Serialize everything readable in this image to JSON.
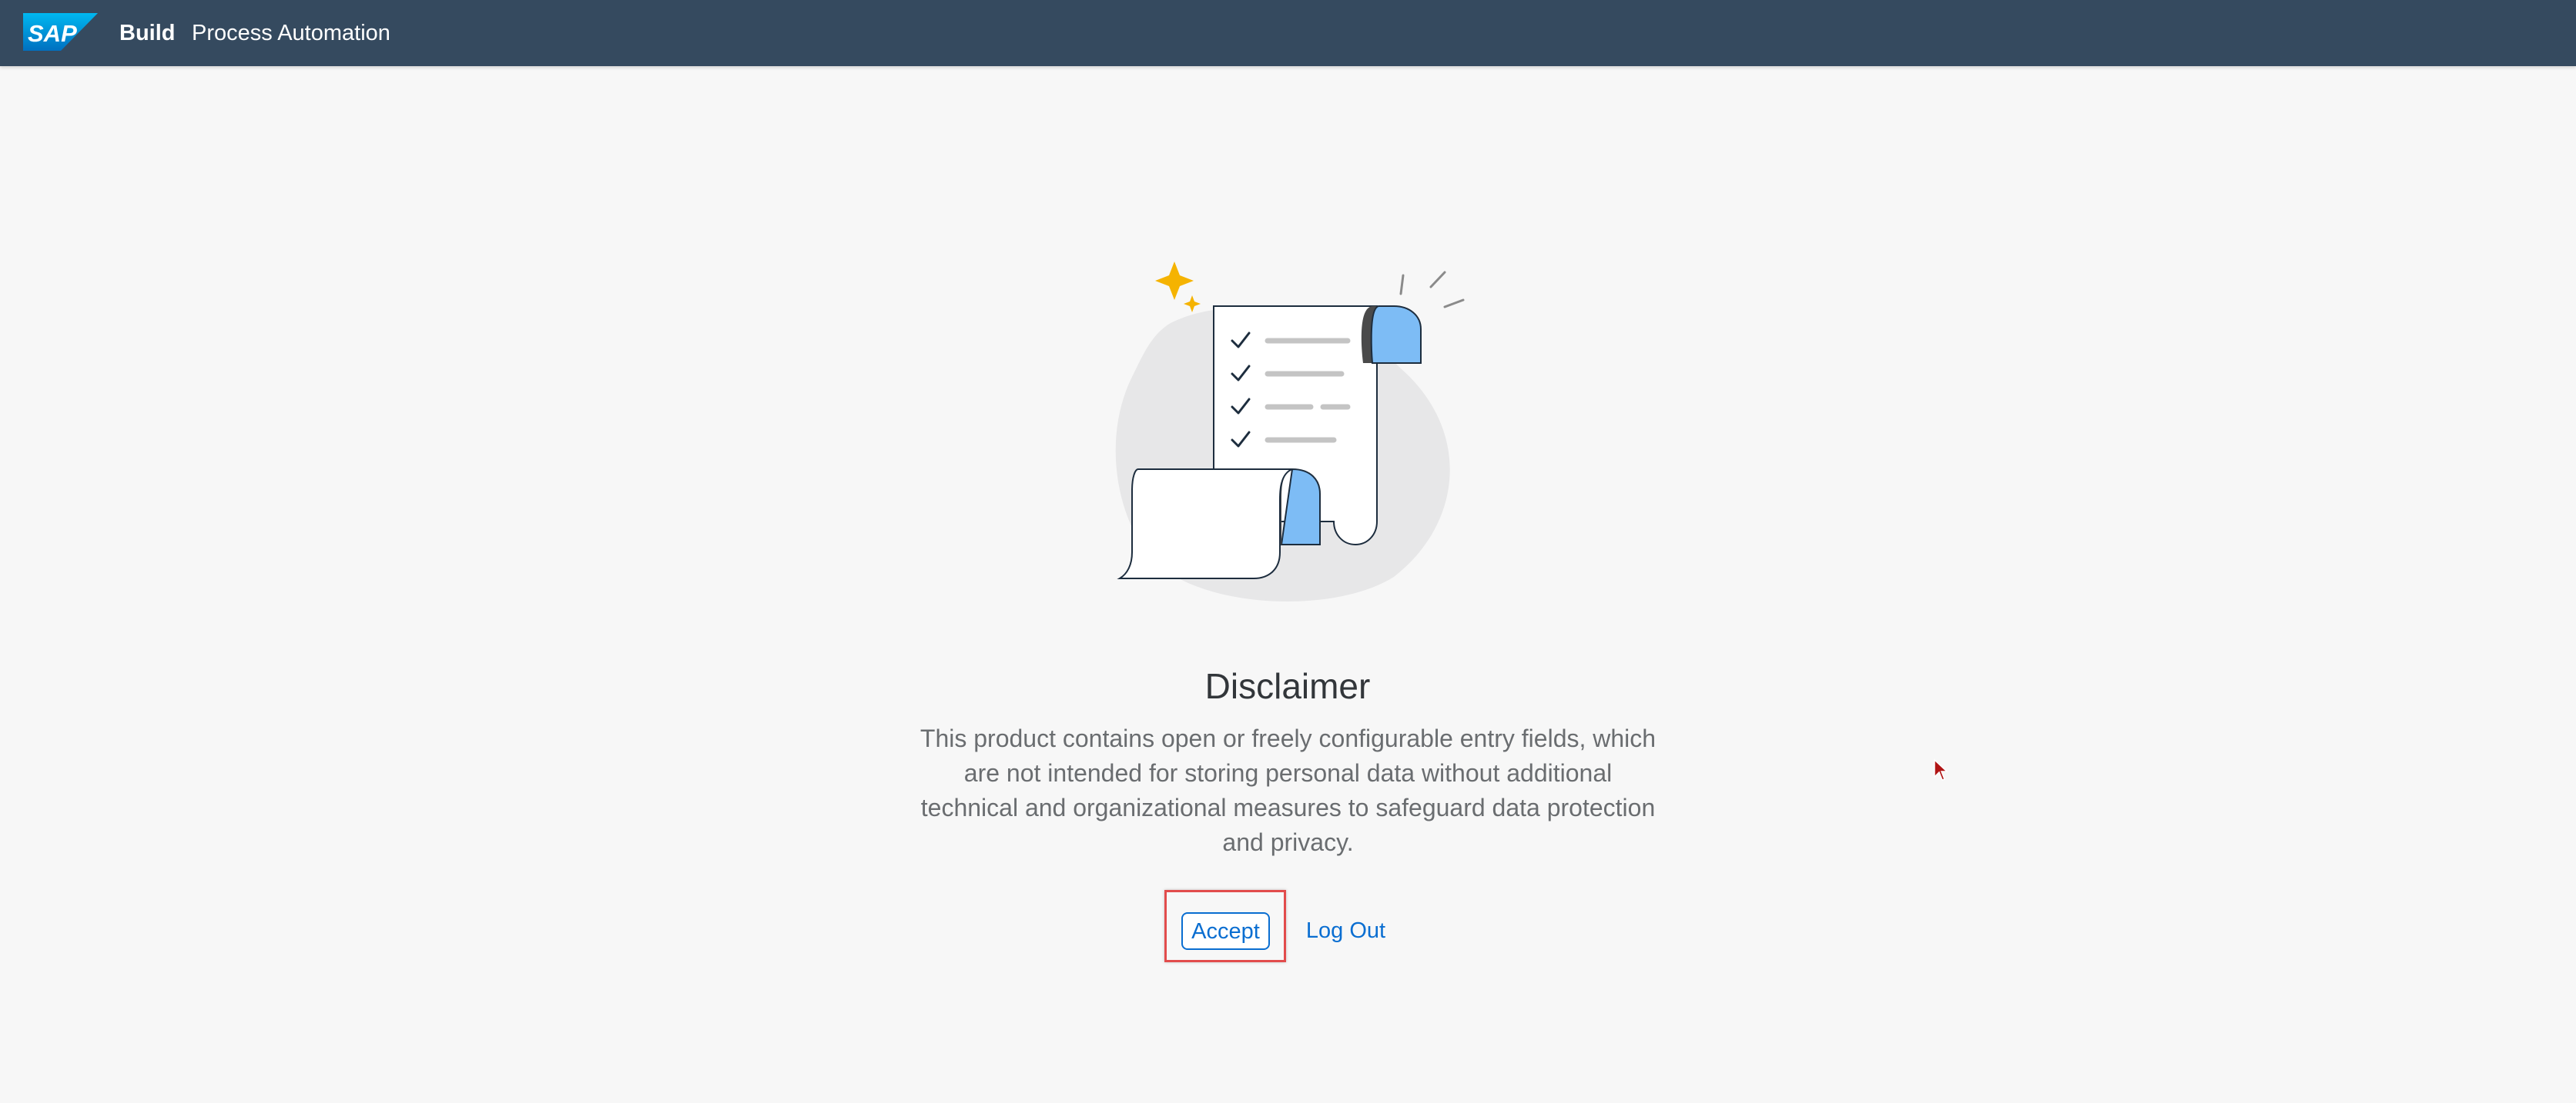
{
  "shellbar": {
    "logo_text": "SAP",
    "product_bold": "Build",
    "product_name": "Process Automation",
    "background_color": "#354a5f"
  },
  "illustration": {
    "icon": "document-checklist-scroll-illustration"
  },
  "disclaimer": {
    "title": "Disclaimer",
    "message": "This product contains open or freely configurable entry fields, which are not intended for storing personal data without additional technical and organizational measures to safeguard data protection and privacy."
  },
  "actions": {
    "accept_label": "Accept",
    "logout_label": "Log Out",
    "link_color": "#0a6ed1",
    "highlight_color": "#e24c4c"
  },
  "cursor": {
    "icon": "mouse-pointer-icon"
  }
}
